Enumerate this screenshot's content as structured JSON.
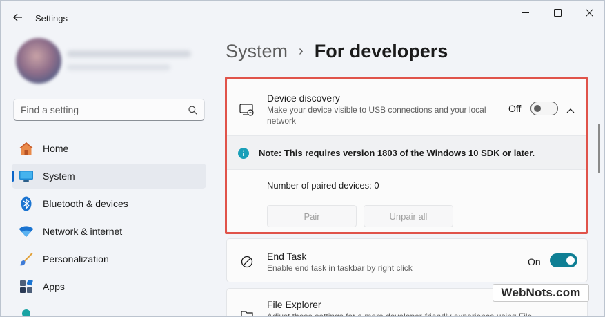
{
  "window": {
    "title": "Settings"
  },
  "search": {
    "placeholder": "Find a setting"
  },
  "sidebar": {
    "items": [
      {
        "label": "Home",
        "icon": "home-icon",
        "active": false
      },
      {
        "label": "System",
        "icon": "system-icon",
        "active": true
      },
      {
        "label": "Bluetooth & devices",
        "icon": "bluetooth-icon",
        "active": false
      },
      {
        "label": "Network & internet",
        "icon": "network-icon",
        "active": false
      },
      {
        "label": "Personalization",
        "icon": "personalization-icon",
        "active": false
      },
      {
        "label": "Apps",
        "icon": "apps-icon",
        "active": false
      }
    ]
  },
  "breadcrumb": {
    "parent": "System",
    "separator": "›",
    "current": "For developers"
  },
  "device_discovery": {
    "title": "Device discovery",
    "description": "Make your device visible to USB connections and your local network",
    "toggle_label": "Off",
    "toggle_state": false,
    "note": "Note: This requires version 1803 of the Windows 10 SDK or later.",
    "paired_devices": "Number of paired devices: 0",
    "pair_button": "Pair",
    "unpair_button": "Unpair all"
  },
  "end_task": {
    "title": "End Task",
    "description": "Enable end task in taskbar by right click",
    "toggle_label": "On",
    "toggle_state": true
  },
  "file_explorer": {
    "title": "File Explorer",
    "description": "Adjust these settings for a more developer-friendly experience using File"
  },
  "watermark": {
    "text": "WebNots.com"
  },
  "colors": {
    "accent": "#0f7f94",
    "highlight_border": "#e0534a",
    "info_icon": "#1a9fb8",
    "nav_indicator": "#0a64c8"
  }
}
